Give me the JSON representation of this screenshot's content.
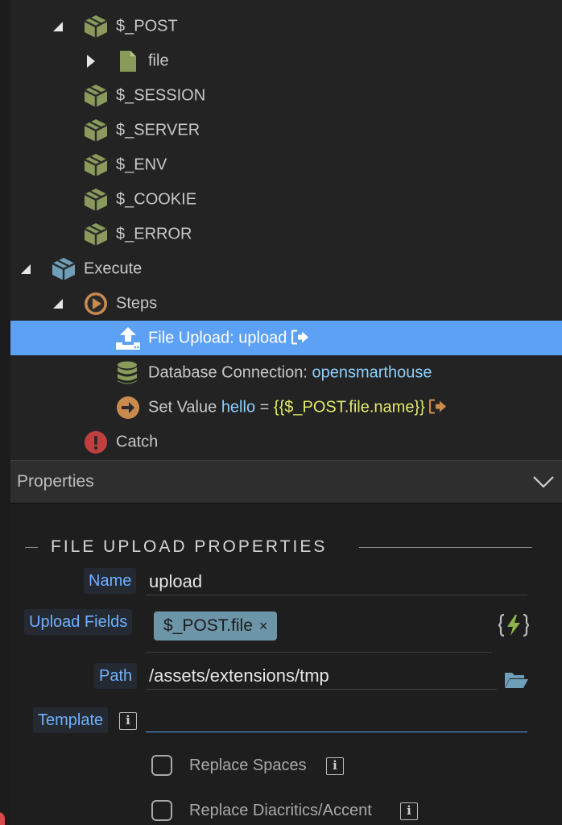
{
  "tree": {
    "items": [
      {
        "label": "$_POST",
        "icon": "package-icon"
      },
      {
        "label": "file",
        "icon": "file-icon"
      },
      {
        "label": "$_SESSION",
        "icon": "package-icon"
      },
      {
        "label": "$_SERVER",
        "icon": "package-icon"
      },
      {
        "label": "$_ENV",
        "icon": "package-icon"
      },
      {
        "label": "$_COOKIE",
        "icon": "package-icon"
      },
      {
        "label": "$_ERROR",
        "icon": "package-icon"
      },
      {
        "label": "Execute",
        "icon": "package-icon"
      },
      {
        "label": "Steps",
        "icon": "play-circle-icon"
      },
      {
        "label": "File Upload: upload",
        "icon": "upload-icon"
      },
      {
        "label": "Database Connection:",
        "value": "opensmarthouse",
        "icon": "database-icon"
      },
      {
        "label": "Set Value",
        "name": "hello",
        "eq": "=",
        "expr": "{{$_POST.file.name}}",
        "icon": "arrow-right-circle-icon"
      },
      {
        "label": "Catch",
        "icon": "alert-circle-icon"
      }
    ]
  },
  "properties": {
    "header": "Properties",
    "section_title": "FILE UPLOAD PROPERTIES",
    "fields": {
      "name_label": "Name",
      "name_value": "upload",
      "upload_fields_label": "Upload Fields",
      "upload_fields_tag": "$_POST.file",
      "tag_remove": "×",
      "path_label": "Path",
      "path_value": "/assets/extensions/tmp",
      "template_label": "Template",
      "template_value": ""
    },
    "checkboxes": [
      {
        "label": "Replace Spaces",
        "checked": false
      },
      {
        "label": "Replace Diacritics/Accent",
        "checked": false
      }
    ],
    "info_glyph": "i"
  },
  "colors": {
    "selection": "#5da1f5",
    "package": "#8a9a5b",
    "accent_blue": "#6fb1ff",
    "tag": "#6c95a8"
  }
}
